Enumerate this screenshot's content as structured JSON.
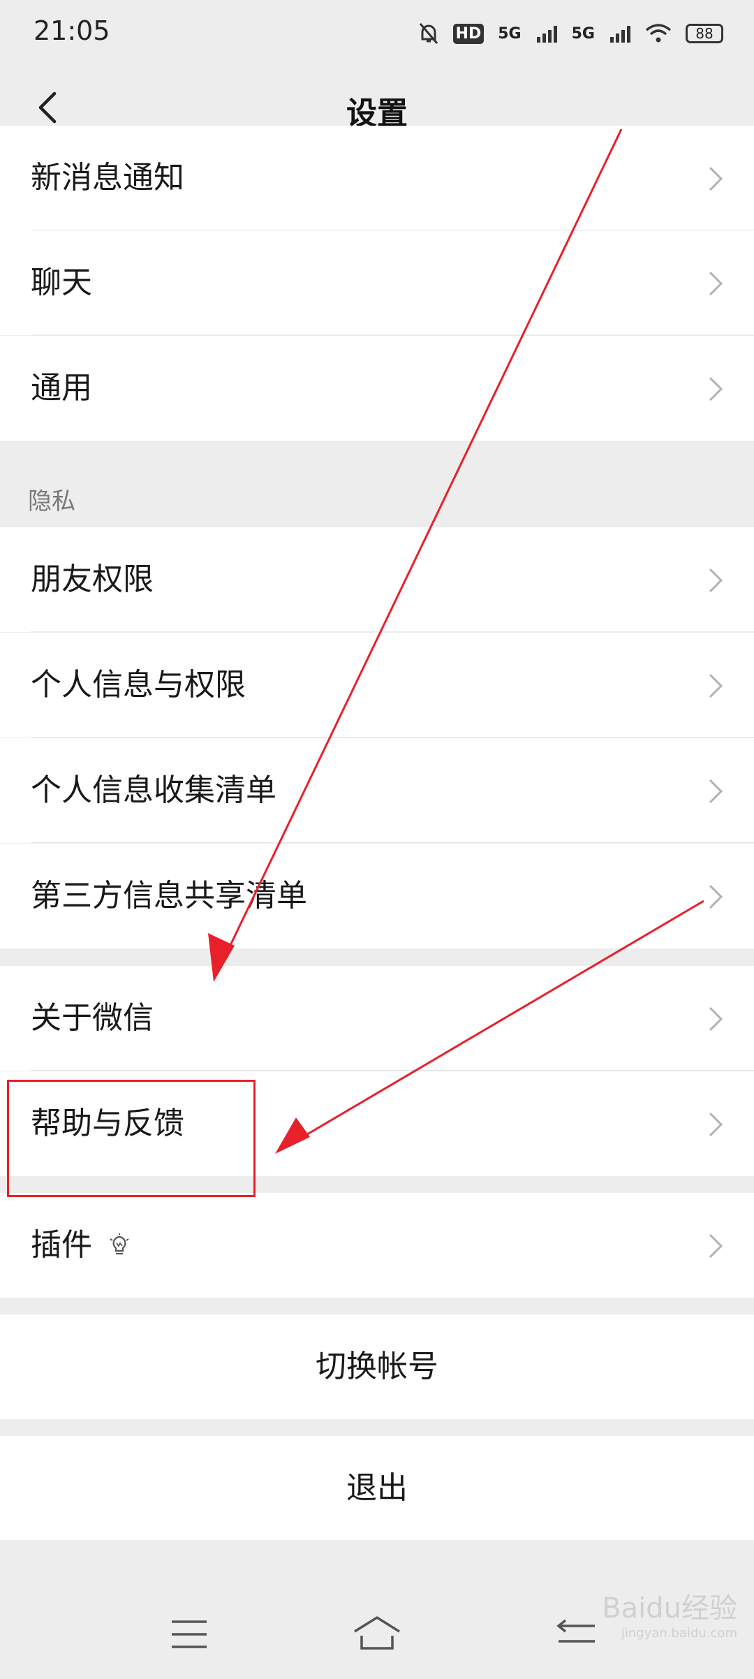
{
  "status": {
    "time": "21:05",
    "hd_label": "HD",
    "net1": "5G",
    "net2": "5G",
    "battery": "88"
  },
  "header": {
    "title": "设置"
  },
  "rows": {
    "notifications": "新消息通知",
    "chat": "聊天",
    "general": "通用",
    "privacy_header": "隐私",
    "friend_permissions": "朋友权限",
    "personal_info": "个人信息与权限",
    "info_collection": "个人信息收集清单",
    "third_party": "第三方信息共享清单",
    "about": "关于微信",
    "help": "帮助与反馈",
    "plugins": "插件"
  },
  "actions": {
    "switch_account": "切换帐号",
    "logout": "退出"
  },
  "watermark": {
    "brand": "Baidu经验",
    "url": "jingyan.baidu.com"
  },
  "colors": {
    "annotation": "#e8202a",
    "background": "#ededed",
    "row": "#ffffff"
  }
}
